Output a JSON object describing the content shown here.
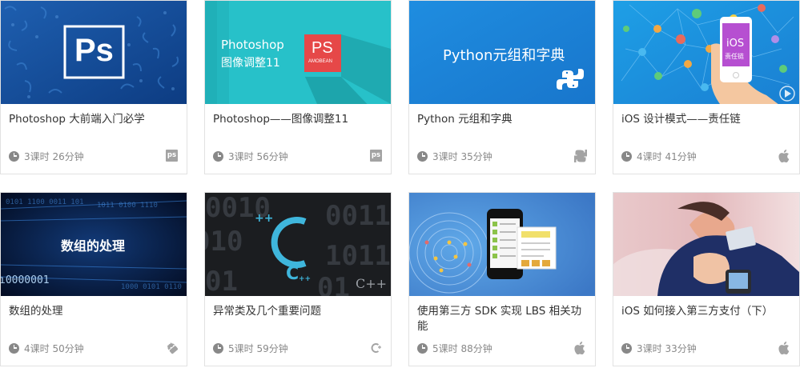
{
  "courses": [
    {
      "title": "Photoshop 大前端入门必学",
      "duration": "3课时 26分钟",
      "thumb_text": "Ps",
      "category_icon": "photoshop-icon",
      "category_badge": "ps"
    },
    {
      "title": "Photoshop——图像调整11",
      "duration": "3课时 56分钟",
      "thumb_line1": "Photoshop",
      "thumb_line2": "图像调整11",
      "thumb_logo": "PS",
      "thumb_logo_sub": "AMOBEAN",
      "category_icon": "photoshop-icon",
      "category_badge": "ps"
    },
    {
      "title": "Python 元组和字典",
      "duration": "3课时 35分钟",
      "thumb_text": "Python元组和字典",
      "category_icon": "python-icon"
    },
    {
      "title": "iOS 设计模式——责任链",
      "duration": "4课时 41分钟",
      "thumb_line1": "iOS",
      "thumb_line2": "责任链",
      "category_icon": "apple-icon"
    },
    {
      "title": "数组的处理",
      "duration": "4课时 50分钟",
      "thumb_text": "数组的处理",
      "category_icon": "android-icon"
    },
    {
      "title": "异常类及几个重要问题",
      "duration": "5课时 59分钟",
      "thumb_text": "C++",
      "category_icon": "cplusplus-icon"
    },
    {
      "title": "使用第三方 SDK 实现 LBS 相关功能",
      "duration": "5课时 88分钟",
      "category_icon": "apple-icon"
    },
    {
      "title": "iOS 如何接入第三方支付（下）",
      "duration": "3课时 33分钟",
      "category_icon": "apple-icon"
    }
  ],
  "colors": {
    "border": "#e2e2e2",
    "meta_text": "#888888",
    "title_text": "#333333"
  }
}
